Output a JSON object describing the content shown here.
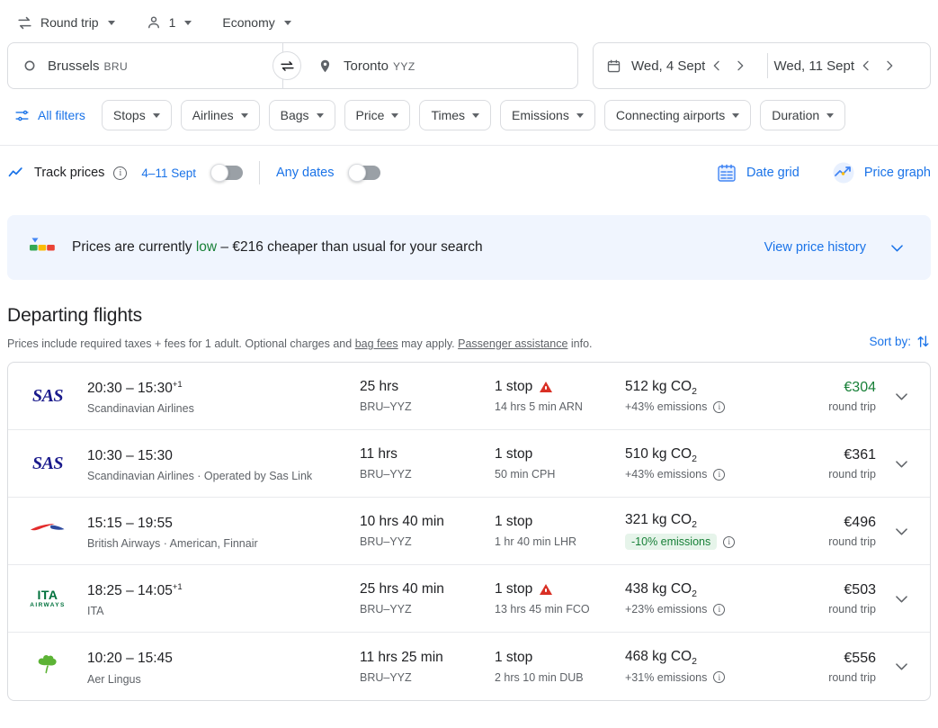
{
  "trip_controls": {
    "trip_type": {
      "label": "Round trip",
      "icon": "swap-horizontal-icon"
    },
    "passengers": {
      "label": "1",
      "icon": "person-icon"
    },
    "cabin_class": {
      "label": "Economy"
    }
  },
  "search": {
    "origin": {
      "city": "Brussels",
      "code": "BRU",
      "icon": "circle-origin-icon"
    },
    "destination": {
      "city": "Toronto",
      "code": "YYZ",
      "icon": "location-pin-icon"
    },
    "swap_icon": "swap-arrows-icon",
    "calendar_icon": "calendar-icon",
    "depart_date": "Wed, 4 Sept",
    "return_date": "Wed, 11 Sept",
    "prev_icon": "chevron-left-icon",
    "next_icon": "chevron-right-icon"
  },
  "filters": {
    "all_filters_label": "All filters",
    "all_filters_icon": "tune-icon",
    "chips": [
      {
        "label": "Stops"
      },
      {
        "label": "Airlines"
      },
      {
        "label": "Bags"
      },
      {
        "label": "Price"
      },
      {
        "label": "Times"
      },
      {
        "label": "Emissions"
      },
      {
        "label": "Connecting airports"
      },
      {
        "label": "Duration"
      }
    ]
  },
  "track_prices": {
    "icon": "trending-line-icon",
    "label": "Track prices",
    "info_icon": "info-icon",
    "date_range_label": "4–11 Sept",
    "date_range_toggle_on": false,
    "any_dates_label": "Any dates",
    "any_dates_toggle_on": false,
    "date_grid_label": "Date grid",
    "date_grid_icon": "calendar-grid-icon",
    "price_graph_label": "Price graph",
    "price_graph_icon": "price-graph-icon"
  },
  "price_banner": {
    "icon": "price-level-bar-icon",
    "prefix": "Prices are currently ",
    "highlight": "low",
    "suffix": " – €216 cheaper than usual for your search",
    "link_label": "View price history",
    "expand_icon": "chevron-down-icon"
  },
  "departing": {
    "title": "Departing flights",
    "note_part1": "Prices include required taxes + fees for 1 adult. Optional charges and ",
    "note_link1": "bag fees",
    "note_part2": " may apply. ",
    "note_link2": "Passenger assistance",
    "note_part3": " info.",
    "sort_label": "Sort by:",
    "sort_icon": "sort-arrows-icon"
  },
  "flights": [
    {
      "logo": "sas-logo",
      "times": "20:30 – 15:30",
      "day_offset": "+1",
      "airline": "Scandinavian Airlines",
      "duration": "25 hrs",
      "route": "BRU–YYZ",
      "stops": "1 stop",
      "warning": true,
      "layover": "14 hrs 5 min ARN",
      "co2": "512 kg CO",
      "co2_sub": "2",
      "emissions": "+43% emissions",
      "emissions_badge": false,
      "emissions_info_icon": "info-icon",
      "price": "€304",
      "price_green": true,
      "price_sub": "round trip",
      "expand_icon": "chevron-down-icon"
    },
    {
      "logo": "sas-logo",
      "times": "10:30 – 15:30",
      "day_offset": "",
      "airline": "Scandinavian Airlines · Operated by Sas Link",
      "duration": "11 hrs",
      "route": "BRU–YYZ",
      "stops": "1 stop",
      "warning": false,
      "layover": "50 min CPH",
      "co2": "510 kg CO",
      "co2_sub": "2",
      "emissions": "+43% emissions",
      "emissions_badge": false,
      "emissions_info_icon": "info-icon",
      "price": "€361",
      "price_green": false,
      "price_sub": "round trip",
      "expand_icon": "chevron-down-icon"
    },
    {
      "logo": "british-airways-logo",
      "times": "15:15 – 19:55",
      "day_offset": "",
      "airline": "British Airways · American, Finnair",
      "duration": "10 hrs 40 min",
      "route": "BRU–YYZ",
      "stops": "1 stop",
      "warning": false,
      "layover": "1 hr 40 min LHR",
      "co2": "321 kg CO",
      "co2_sub": "2",
      "emissions": "-10% emissions",
      "emissions_badge": true,
      "emissions_info_icon": "info-icon",
      "price": "€496",
      "price_green": false,
      "price_sub": "round trip",
      "expand_icon": "chevron-down-icon"
    },
    {
      "logo": "ita-airways-logo",
      "times": "18:25 – 14:05",
      "day_offset": "+1",
      "airline": "ITA",
      "duration": "25 hrs 40 min",
      "route": "BRU–YYZ",
      "stops": "1 stop",
      "warning": true,
      "layover": "13 hrs 45 min FCO",
      "co2": "438 kg CO",
      "co2_sub": "2",
      "emissions": "+23% emissions",
      "emissions_badge": false,
      "emissions_info_icon": "info-icon",
      "price": "€503",
      "price_green": false,
      "price_sub": "round trip",
      "expand_icon": "chevron-down-icon"
    },
    {
      "logo": "aer-lingus-logo",
      "times": "10:20 – 15:45",
      "day_offset": "",
      "airline": "Aer Lingus",
      "duration": "11 hrs 25 min",
      "route": "BRU–YYZ",
      "stops": "1 stop",
      "warning": false,
      "layover": "2 hrs 10 min DUB",
      "co2": "468 kg CO",
      "co2_sub": "2",
      "emissions": "+31% emissions",
      "emissions_badge": false,
      "emissions_info_icon": "info-icon",
      "price": "€556",
      "price_green": false,
      "price_sub": "round trip",
      "expand_icon": "chevron-down-icon"
    }
  ],
  "colors": {
    "accent_blue": "#1a73e8",
    "green": "#188038",
    "warning_red": "#d93025",
    "banner_bg": "#f0f5fe"
  }
}
